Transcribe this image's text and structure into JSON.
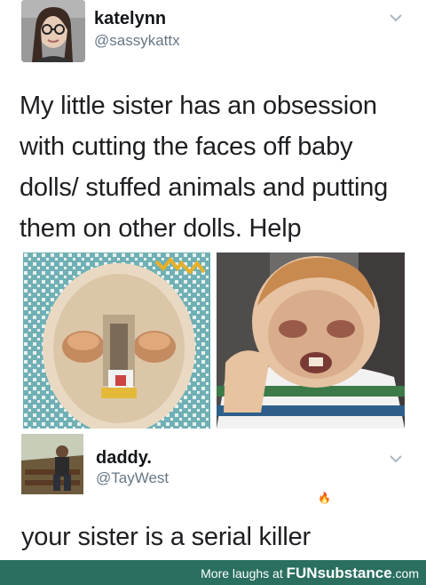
{
  "tweet": {
    "author_name": "katelynn",
    "author_handle": "@sassykattx",
    "text": "My little sister has an obsession with cutting the faces off baby dolls/ stuffed animals and putting them on other dolls. Help",
    "media": [
      {
        "icon": "doll-face-mask-photo"
      },
      {
        "icon": "doll-wearing-face-photo"
      }
    ]
  },
  "reply": {
    "author_name": "daddy.",
    "author_handle": "@TayWest",
    "text": "your sister is a serial killer",
    "icon": "fire-icon"
  },
  "footer": {
    "prefix": "More laughs at ",
    "brand": "FUNsubstance",
    "suffix": ".com",
    "background": "#2a6f60"
  },
  "colors": {
    "handle": "#657786",
    "text": "#1c1e21"
  }
}
